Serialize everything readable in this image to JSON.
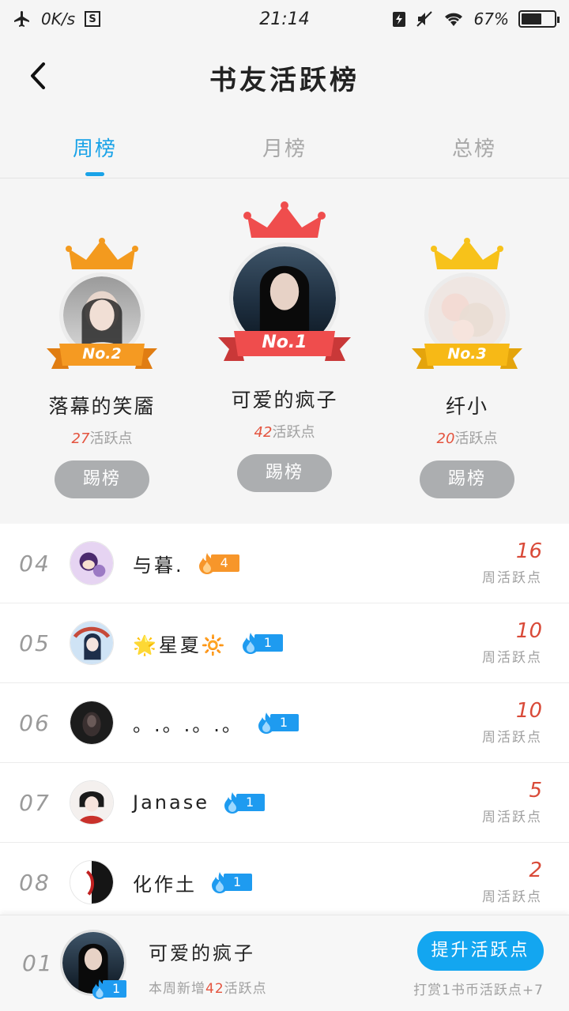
{
  "status_bar": {
    "net_speed": "0K/s",
    "time": "21:14",
    "battery_percent": "67%",
    "battery_level": 0.67,
    "icons": [
      "airplane-icon",
      "s-app-icon",
      "charging-icon",
      "mute-icon",
      "wifi-icon",
      "battery-icon"
    ]
  },
  "header": {
    "title": "书友活跃榜"
  },
  "tabs": [
    {
      "label": "周榜",
      "active": true
    },
    {
      "label": "月榜",
      "active": false
    },
    {
      "label": "总榜",
      "active": false
    }
  ],
  "podium": [
    {
      "place": "No.2",
      "name": "落幕的笑靥",
      "points": "27",
      "points_suffix": "活跃点",
      "button": "踢榜"
    },
    {
      "place": "No.1",
      "name": "可爱的疯子",
      "points": "42",
      "points_suffix": "活跃点",
      "button": "踢榜"
    },
    {
      "place": "No.3",
      "name": "纤小",
      "points": "20",
      "points_suffix": "活跃点",
      "button": "踢榜"
    }
  ],
  "list": [
    {
      "rank": "04",
      "name": "与暮.",
      "level": "4",
      "score": "16",
      "score_label": "周活跃点"
    },
    {
      "rank": "05",
      "name": "🌟星夏🔆",
      "level": "1",
      "score": "10",
      "score_label": "周活跃点"
    },
    {
      "rank": "06",
      "name": "。.。.。.。",
      "level": "1",
      "score": "10",
      "score_label": "周活跃点"
    },
    {
      "rank": "07",
      "name": "Janase",
      "level": "1",
      "score": "5",
      "score_label": "周活跃点"
    },
    {
      "rank": "08",
      "name": "化作土",
      "level": "1",
      "score": "2",
      "score_label": "周活跃点"
    }
  ],
  "footer": {
    "rank": "01",
    "name": "可爱的疯子",
    "level": "1",
    "sub_prefix": "本周新增",
    "sub_points": "42",
    "sub_suffix": "活跃点",
    "button": "提升活跃点",
    "hint": "打赏1书币活跃点+7"
  },
  "colors": {
    "accent": "#1aa3e8",
    "gold": "#f2a511",
    "silver_crown": "#f39a1e",
    "red": "#ef4d4d",
    "score": "#d94a38",
    "level_orange": "#f7962a",
    "level_blue": "#1e9bf0"
  }
}
